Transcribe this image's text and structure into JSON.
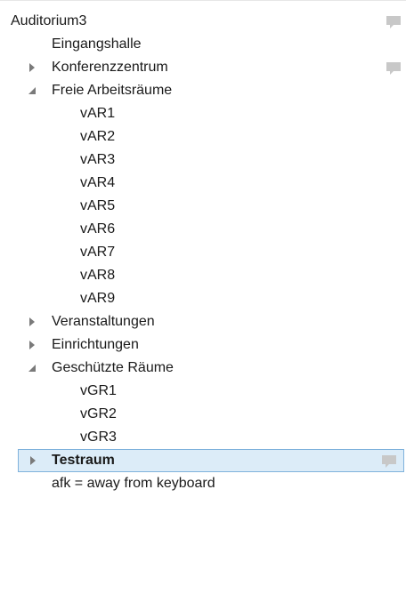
{
  "tree": {
    "root_label": "Auditorium3",
    "items": [
      {
        "label": "Eingangshalle"
      },
      {
        "label": "Konferenzzentrum"
      },
      {
        "label": "Freie Arbeitsräume"
      },
      {
        "label": "vAR1"
      },
      {
        "label": "vAR2"
      },
      {
        "label": "vAR3"
      },
      {
        "label": "vAR4"
      },
      {
        "label": "vAR5"
      },
      {
        "label": "vAR6"
      },
      {
        "label": "vAR7"
      },
      {
        "label": "vAR8"
      },
      {
        "label": "vAR9"
      },
      {
        "label": "Veranstaltungen"
      },
      {
        "label": "Einrichtungen"
      },
      {
        "label": "Geschützte Räume"
      },
      {
        "label": "vGR1"
      },
      {
        "label": "vGR2"
      },
      {
        "label": "vGR3"
      },
      {
        "label": "Testraum"
      },
      {
        "label": "afk = away from keyboard"
      }
    ]
  },
  "colors": {
    "selection_bg": "#dcecf8",
    "selection_border": "#7fb2dc",
    "icon_gray": "#c8c8c8",
    "arrow_gray": "#7a7a7a"
  },
  "icons": {
    "collapsed": "triangle-right-icon",
    "expanded": "triangle-down-icon",
    "comment": "comment-icon"
  }
}
